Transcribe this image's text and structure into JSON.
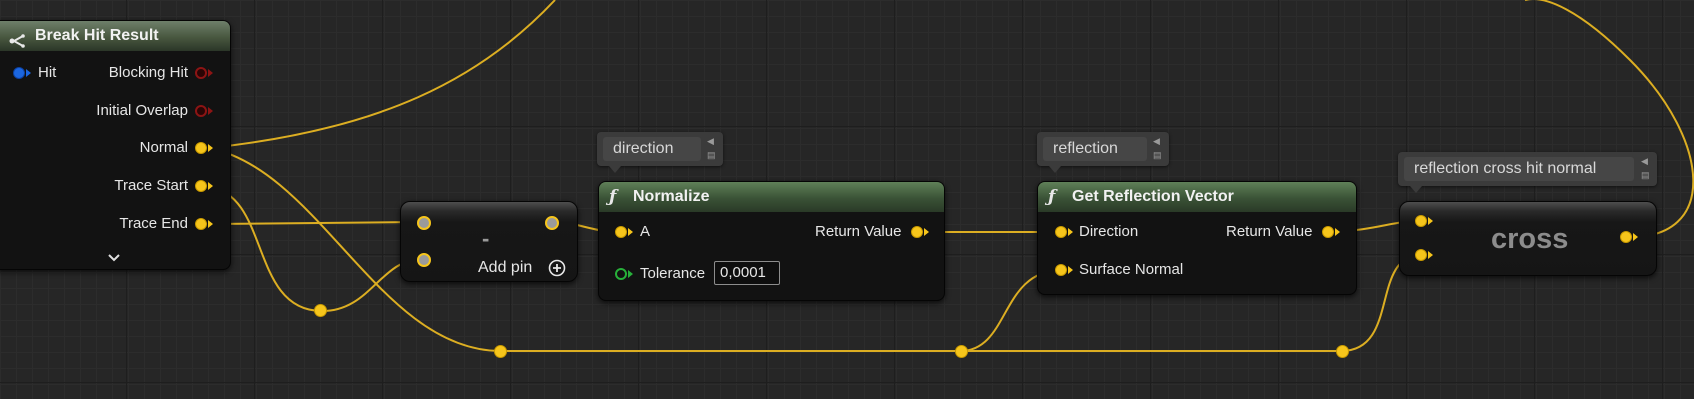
{
  "nodes": {
    "break_hit_result": {
      "title": "Break Hit Result",
      "input_pin": "Hit",
      "output_pins": [
        "Blocking Hit",
        "Initial Overlap",
        "Normal",
        "Trace Start",
        "Trace End"
      ],
      "expand_icon": "chevron-down-icon"
    },
    "subtract": {
      "symbol": "-",
      "add_pin_label": "Add pin",
      "add_pin_icon": "plus-circle-icon"
    },
    "normalize": {
      "title": "Normalize",
      "icon": "function-icon",
      "input_a": "A",
      "input_tolerance": "Tolerance",
      "tolerance_value": "0,0001",
      "output": "Return Value"
    },
    "get_reflection_vector": {
      "title": "Get Reflection Vector",
      "icon": "function-icon",
      "input_direction": "Direction",
      "input_surface_normal": "Surface Normal",
      "output": "Return Value"
    },
    "cross": {
      "title": "cross"
    }
  },
  "comments": {
    "direction": "direction",
    "reflection": "reflection",
    "cross": "reflection cross hit normal"
  },
  "colors": {
    "vector_pin": "#f6c51b",
    "struct_pin": "#1b66e0",
    "bool_pin": "#8c1414",
    "float_pin": "#27b03a",
    "function_header": "#4e6c47",
    "wire": "#dcae22"
  }
}
